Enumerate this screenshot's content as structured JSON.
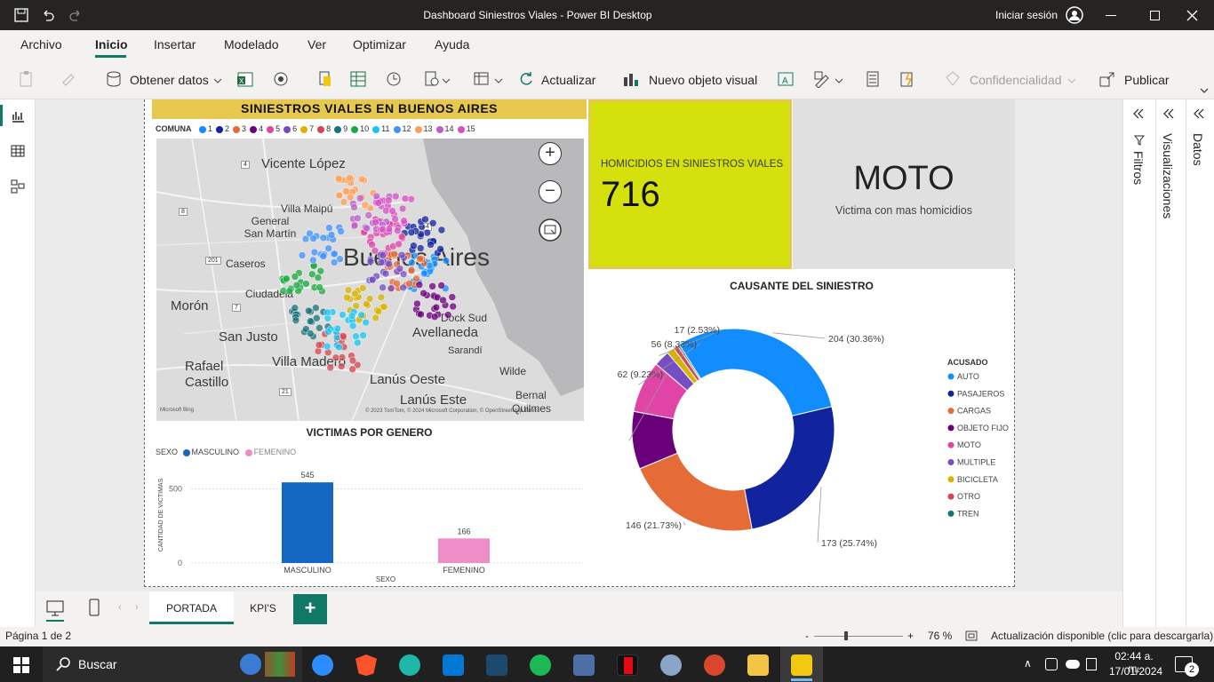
{
  "window": {
    "title": "Dashboard Siniestros Viales - Power BI Desktop",
    "signin": "Iniciar sesión"
  },
  "menu": [
    "Archivo",
    "Inicio",
    "Insertar",
    "Modelado",
    "Ver",
    "Optimizar",
    "Ayuda"
  ],
  "menu_active": "Inicio",
  "ribbon": {
    "get_data": "Obtener datos",
    "refresh": "Actualizar",
    "new_visual": "Nuevo objeto visual",
    "sensitivity": "Confidencialidad",
    "publish": "Publicar"
  },
  "right_panes": {
    "filters": "Filtros",
    "visualizations": "Visualizaciones",
    "data": "Datos"
  },
  "map": {
    "title": "SINIESTROS VIALES EN BUENOS AIRES",
    "legend_title": "COMUNA",
    "legend": [
      {
        "label": "1",
        "color": "#118DFF"
      },
      {
        "label": "2",
        "color": "#12239E"
      },
      {
        "label": "3",
        "color": "#E66C37"
      },
      {
        "label": "4",
        "color": "#6B007B"
      },
      {
        "label": "5",
        "color": "#E044A7"
      },
      {
        "label": "6",
        "color": "#744EC2"
      },
      {
        "label": "7",
        "color": "#D9B300"
      },
      {
        "label": "8",
        "color": "#D64550"
      },
      {
        "label": "9",
        "color": "#197278"
      },
      {
        "label": "10",
        "color": "#1AAB40"
      },
      {
        "label": "11",
        "color": "#15C6F4"
      },
      {
        "label": "12",
        "color": "#4092FF"
      },
      {
        "label": "13",
        "color": "#FFA058"
      },
      {
        "label": "14",
        "color": "#BE5DC9"
      },
      {
        "label": "15",
        "color": "#D84FC3"
      }
    ],
    "places": [
      "Vicente López",
      "Villa Maipú",
      "General San Martín",
      "Caseros",
      "Morón",
      "Ciudadela",
      "San Justo",
      "Villa Madero",
      "Rafael Castillo",
      "Buenos Aires",
      "Avellaneda",
      "Dock Sud",
      "Sarandí",
      "Lanús Oeste",
      "Lanús Este",
      "Wilde",
      "Bernal",
      "Quilmes"
    ],
    "road_numbers": [
      "4",
      "8",
      "201",
      "7",
      "21",
      "4"
    ],
    "attribution": "© 2023 TomTom, © 2024 Microsoft Corporation, © OpenStreetMap Terms",
    "bing": "Microsoft Bing"
  },
  "kpi": {
    "label": "HOMICIDIOS EN SINIESTROS VIALES",
    "value": "716"
  },
  "victim": {
    "value": "MOTO",
    "caption": "Victima con mas homicidios"
  },
  "gender_chart_title": "VICTIMAS POR GENERO",
  "donut_title": "CAUSANTE DEL SINIESTRO",
  "chart_data": [
    {
      "type": "bar",
      "title": "VICTIMAS POR GENERO",
      "legend_title": "SEXO",
      "categories": [
        "MASCULINO",
        "FEMENINO"
      ],
      "values": [
        545,
        166
      ],
      "colors": [
        "#1568C1",
        "#EE8DC8"
      ],
      "xlabel": "SEXO",
      "ylabel": "CANTIDAD DE VICTIMAS",
      "yticks": [
        0,
        500
      ],
      "ylim": [
        0,
        600
      ]
    },
    {
      "type": "pie",
      "title": "CAUSANTE DEL SINIESTRO",
      "legend_title": "ACUSADO",
      "categories": [
        "AUTO",
        "PASAJEROS",
        "CARGAS",
        "OBJETO FIJO",
        "MOTO",
        "MULTIPLE",
        "BICICLETA",
        "OTRO",
        "TREN"
      ],
      "values": [
        204,
        173,
        146,
        62,
        56,
        17,
        8,
        5,
        2
      ],
      "colors": [
        "#118DFF",
        "#12239E",
        "#E66C37",
        "#6B007B",
        "#E044A7",
        "#744EC2",
        "#D9B300",
        "#D64550",
        "#197278"
      ],
      "labels": [
        "204 (30.36%)",
        "173 (25.74%)",
        "146 (21.73%)",
        "62 (9.23%)",
        "56 (8.33%)",
        "17 (2.53%)"
      ]
    }
  ],
  "pages": [
    "PORTADA",
    "KPI'S"
  ],
  "status": {
    "page": "Página 1 de 2",
    "zoom": "76 %",
    "update": "Actualización disponible (clic para descargarla)"
  },
  "taskbar": {
    "search": "Buscar",
    "time": "02:44 a. m.",
    "date": "17/01/2024",
    "notifications": "2"
  }
}
